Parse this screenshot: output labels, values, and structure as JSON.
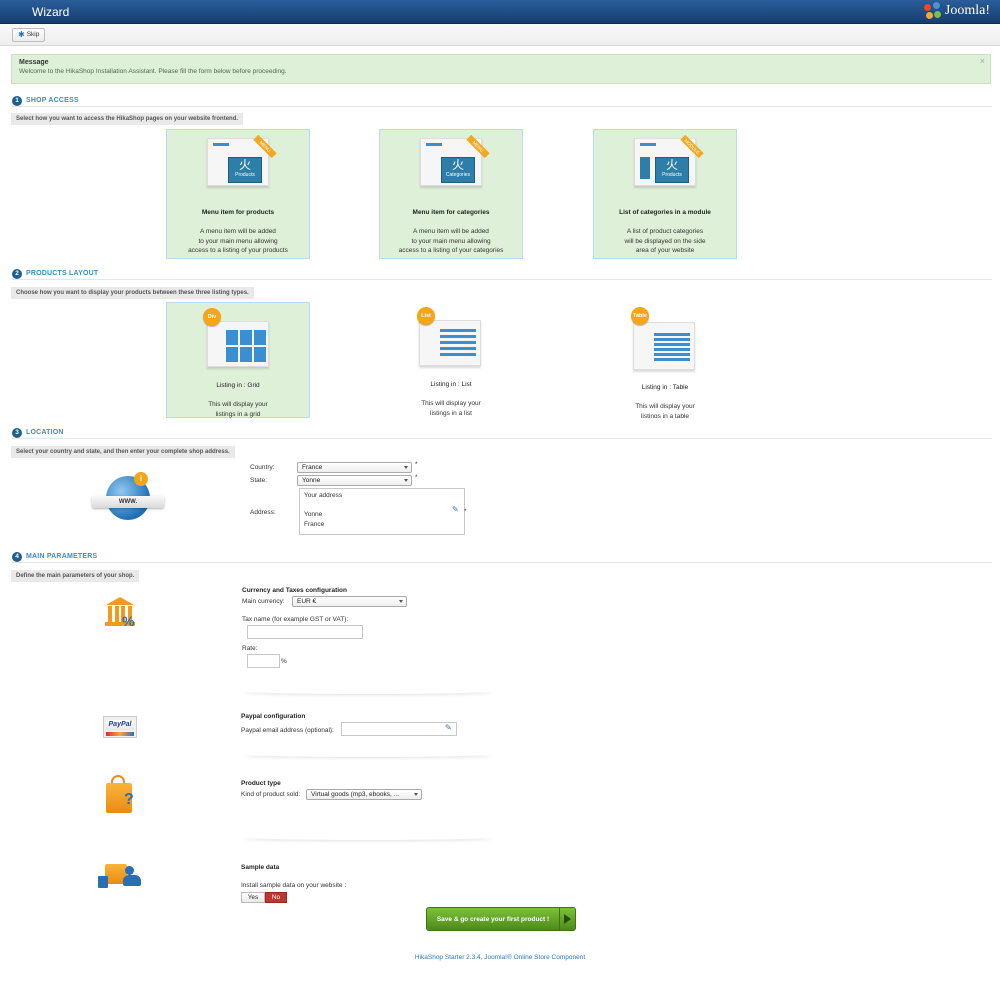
{
  "window": {
    "title": "Wizard",
    "brand": "Joomla!"
  },
  "toolbar": {
    "skip_label": "Skip"
  },
  "message": {
    "heading": "Message",
    "text": "Welcome to the HikaShop Installation Assistant. Please fill the form below before proceeding.",
    "close": "×"
  },
  "sections": {
    "shop_access": {
      "number": "1",
      "title": "SHOP ACCESS",
      "desc": "Select how you want to access the HikaShop pages on your website frontend.",
      "cards": [
        {
          "ribbon": "MENU",
          "screen_label": "Products",
          "caption": "Menu item for products",
          "desc": "A menu item will be added\nto your main menu allowing\naccess to a listing of your products"
        },
        {
          "ribbon": "MENU",
          "screen_label": "Categories",
          "caption": "Menu item for categories",
          "desc": "A menu item will be added\nto your main menu allowing\naccess to a listing of your categories"
        },
        {
          "ribbon": "MODULE",
          "screen_label": "Products",
          "caption": "List of categories in a module",
          "desc": "A list of product categories\nwill be displayed on the side\narea of your website"
        }
      ]
    },
    "products_layout": {
      "number": "2",
      "title": "PRODUCTS LAYOUT",
      "desc": "Choose how you want to display your products between these three listing types.",
      "cards": [
        {
          "badge": "Div",
          "caption": "Listing in : Grid",
          "desc": "This will display your\nlistings in a grid"
        },
        {
          "badge": "List",
          "caption": "Listing in : List",
          "desc": "This will display your\nlistings in a list"
        },
        {
          "badge": "Table",
          "caption": "Listing in : Table",
          "desc": "This will display your\nlistings in a table"
        }
      ]
    },
    "location": {
      "number": "3",
      "title": "LOCATION",
      "desc": "Select your country and state, and then enter your complete shop address.",
      "country_label": "Country:",
      "country_value": "France",
      "state_label": "State:",
      "state_value": "Yonne",
      "address_label": "Address:",
      "address_value": "Your address\n\nYonne\nFrance",
      "required_mark": "*",
      "globe_text": "WWW."
    },
    "main_parameters": {
      "number": "4",
      "title": "MAIN PARAMETERS",
      "desc": "Define the main parameters of your shop.",
      "currency": {
        "heading": "Currency and Taxes configuration",
        "currency_label": "Main currency:",
        "currency_value": "EUR €",
        "tax_label": "Tax name (for example GST or VAT):",
        "rate_label": "Rate:",
        "rate_unit": "%"
      },
      "paypal": {
        "heading": "Paypal configuration",
        "email_label": "Paypal email address (optional):",
        "logo_text": "PayPal"
      },
      "product_type": {
        "heading": "Product type",
        "kind_label": "Kind of product sold:",
        "kind_value": "Virtual goods (mp3, ebooks, ..."
      },
      "sample": {
        "heading": "Sample data",
        "install_label": "Install sample data on your website :",
        "yes": "Yes",
        "no": "No"
      }
    }
  },
  "save_button": "Save & go create your first product !",
  "footer": "HikaShop Starter 2.3.4, Joomla!® Online Store Component"
}
